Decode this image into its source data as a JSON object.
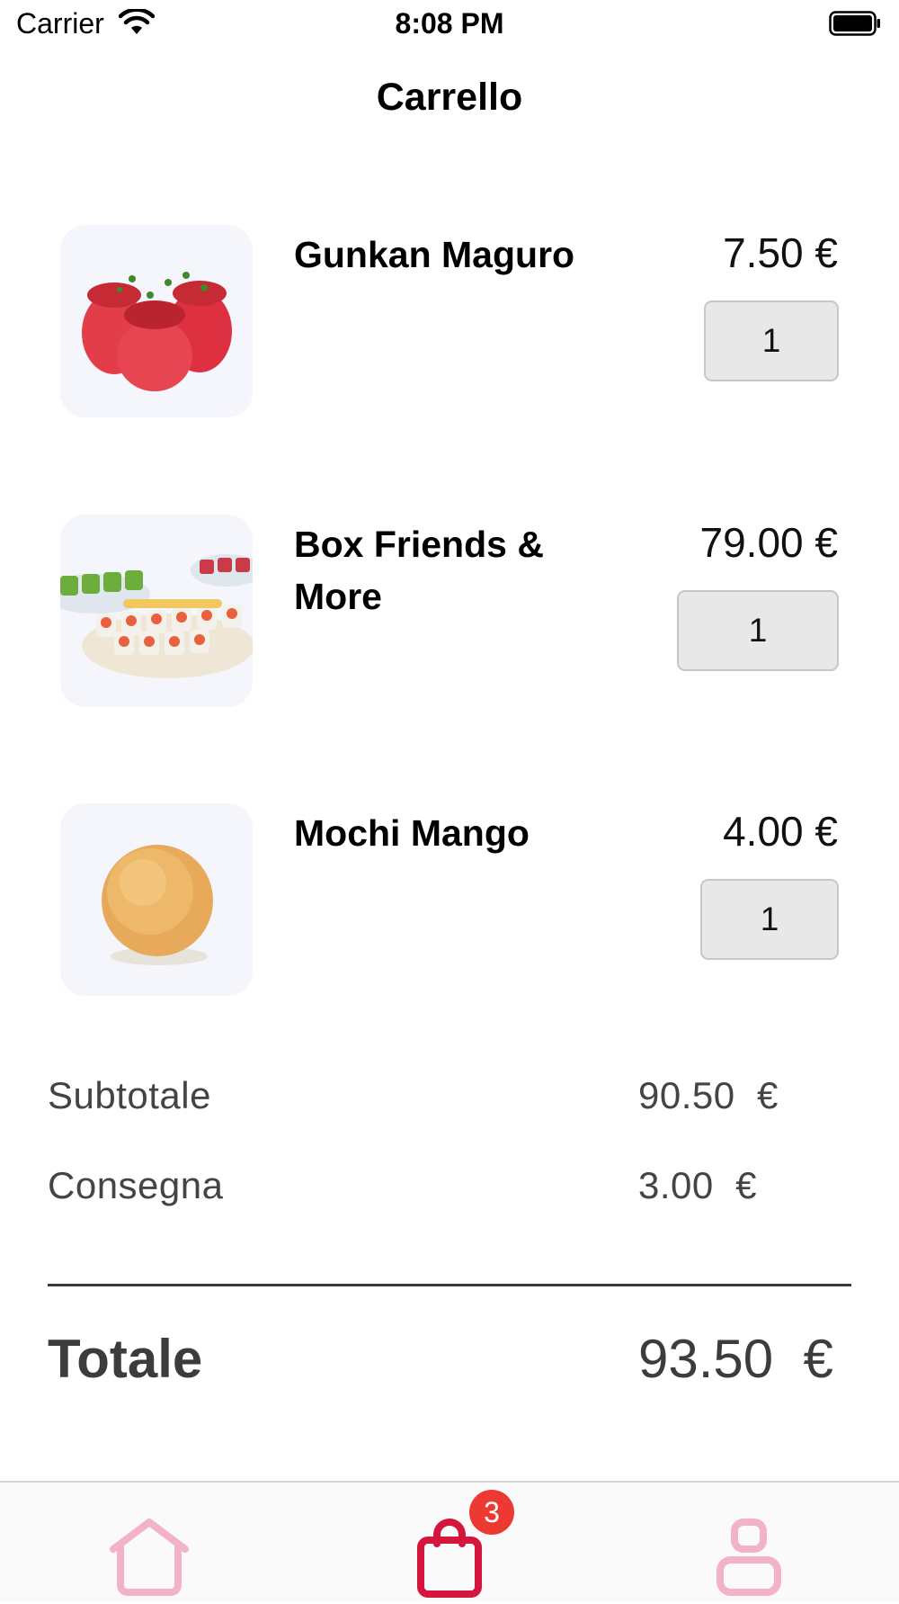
{
  "status_bar": {
    "carrier": "Carrier",
    "time": "8:08 PM"
  },
  "nav": {
    "title": "Carrello"
  },
  "cart_items": [
    {
      "name": "Gunkan Maguro",
      "price": "7.50 €",
      "quantity": "1",
      "image": "gunkan-maguro-photo"
    },
    {
      "name": "Box Friends & More",
      "price": "79.00 €",
      "quantity": "1",
      "image": "box-friends-photo"
    },
    {
      "name": "Mochi Mango",
      "price": "4.00 €",
      "quantity": "1",
      "image": "mochi-mango-photo"
    }
  ],
  "summary": {
    "subtotal_label": "Subtotale",
    "subtotal_value": "90.50  €",
    "delivery_label": "Consegna",
    "delivery_value": "3.00  €",
    "total_label": "Totale",
    "total_value": "93.50  €"
  },
  "tab_bar": {
    "items": [
      {
        "icon": "home-icon"
      },
      {
        "icon": "shopping-bag-icon",
        "badge": "3",
        "active": true
      },
      {
        "icon": "profile-icon"
      }
    ],
    "active_color": "#d4163c",
    "inactive_color": "#f2b3c6"
  }
}
